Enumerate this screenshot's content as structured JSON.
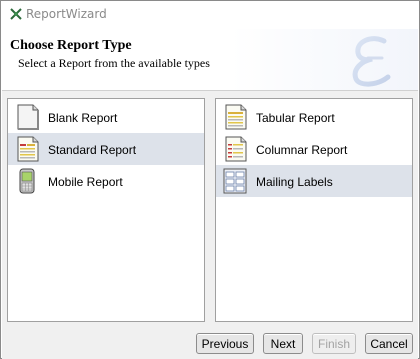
{
  "window": {
    "title": "ReportWizard"
  },
  "header": {
    "title": "Choose Report Type",
    "subtitle": "Select a Report from the available types",
    "logo_icon": "script-e-logo"
  },
  "left_panel": {
    "items": [
      {
        "label": "Blank Report",
        "icon": "blank-page-icon",
        "selected": false
      },
      {
        "label": "Standard Report",
        "icon": "standard-report-icon",
        "selected": true
      },
      {
        "label": "Mobile Report",
        "icon": "mobile-phone-icon",
        "selected": false
      }
    ]
  },
  "right_panel": {
    "items": [
      {
        "label": "Tabular Report",
        "icon": "tabular-report-icon",
        "selected": false
      },
      {
        "label": "Columnar Report",
        "icon": "columnar-report-icon",
        "selected": false
      },
      {
        "label": "Mailing Labels",
        "icon": "mailing-labels-icon",
        "selected": true
      }
    ]
  },
  "buttons": {
    "previous": "Previous",
    "next": "Next",
    "finish": "Finish",
    "cancel": "Cancel"
  },
  "colors": {
    "selection": "#dde2ea",
    "dialog_bg": "#f0f0f0",
    "title_text": "#8a8a8a"
  }
}
